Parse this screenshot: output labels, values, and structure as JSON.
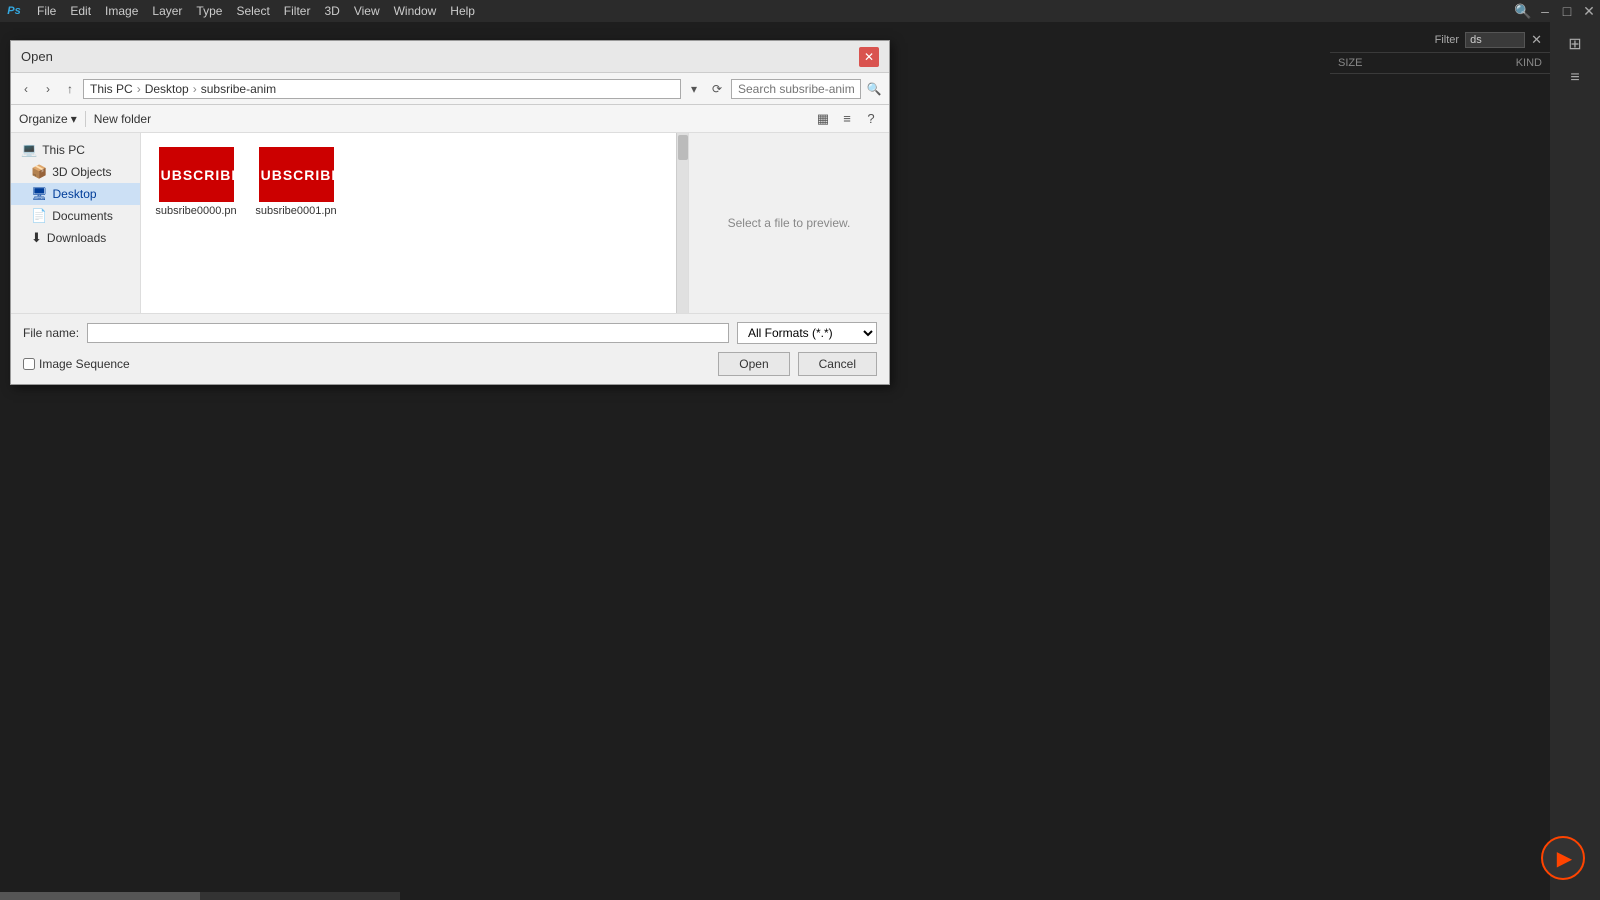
{
  "app": {
    "logo": "Ps",
    "title": "Open"
  },
  "menubar": {
    "items": [
      "File",
      "Edit",
      "Image",
      "Layer",
      "Type",
      "Select",
      "Filter",
      "3D",
      "View",
      "Window",
      "Help"
    ]
  },
  "top_right": {
    "minimize": "–",
    "maximize": "□",
    "close": "✕",
    "search_icon": "🔍"
  },
  "right_panel": {
    "grid_icon": "⊞",
    "list_icon": "≡",
    "filter_label": "Filter",
    "filter_value": "ds",
    "close_filter": "✕",
    "col_size": "SIZE",
    "col_kind": "KIND"
  },
  "dialog": {
    "title": "Open",
    "close": "✕",
    "address_bar": {
      "back": "‹",
      "forward": "›",
      "up": "↑",
      "path_parts": [
        "This PC",
        "Desktop",
        "subsribe-anim"
      ],
      "search_placeholder": "Search subsribe-anim",
      "refresh": "⟳",
      "dropdown": "▾"
    },
    "toolbar": {
      "organize": "Organize",
      "organize_arrow": "▾",
      "new_folder": "New folder",
      "view1": "▦",
      "view2": "≡",
      "help": "?"
    },
    "nav_items": [
      {
        "icon": "💻",
        "label": "This PC"
      },
      {
        "icon": "📦",
        "label": "3D Objects"
      },
      {
        "icon": "🖥",
        "label": "Desktop"
      },
      {
        "icon": "📄",
        "label": "Documents"
      },
      {
        "icon": "⬇",
        "label": "Downloads"
      }
    ],
    "files": [
      {
        "thumbnail_text": "SUBSCRIBE",
        "name": "subsribe0000.pn"
      },
      {
        "thumbnail_text": "SUBSCRIBE",
        "name": "subsribe0001.pn"
      }
    ],
    "preview_text": "Select a file to preview.",
    "filename_label": "File name:",
    "filename_value": "",
    "format_label": "All Formats (*.*)",
    "image_sequence_label": "Image Sequence",
    "open_label": "Open",
    "cancel_label": "Cancel"
  },
  "bottom": {
    "play_icon": "▶"
  }
}
